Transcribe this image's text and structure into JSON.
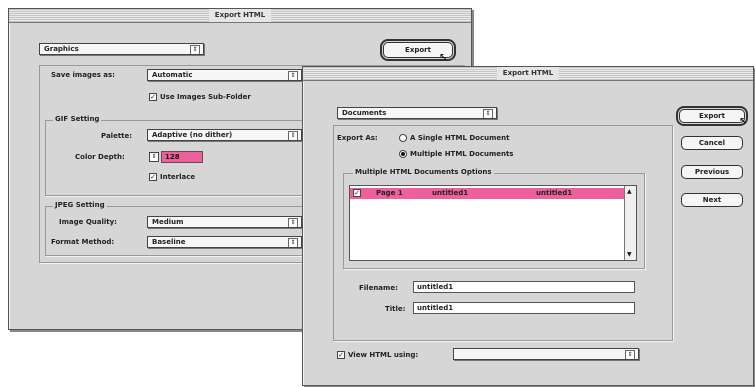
{
  "back_dialog": {
    "title": "Export HTML",
    "category": "Graphics",
    "export_button": "Export",
    "save_images_label": "Save images as:",
    "save_images_value": "Automatic",
    "use_images_subfolder": "Use Images Sub-Folder",
    "gif_setting_title": "GIF Setting",
    "palette_label": "Palette:",
    "palette_value": "Adaptive (no dither)",
    "color_depth_label": "Color Depth:",
    "color_depth_value": "128",
    "interlace_label": "Interlace",
    "jpeg_setting_title": "JPEG Setting",
    "image_quality_label": "Image Quality:",
    "image_quality_value": "Medium",
    "format_method_label": "Format Method:",
    "format_method_value": "Baseline"
  },
  "front_dialog": {
    "title": "Export HTML",
    "category": "Documents",
    "export_as_label": "Export As:",
    "option_single": "A Single HTML Document",
    "option_multiple": "Multiple HTML Documents",
    "options_group_title": "Multiple HTML Documents Options",
    "list_row": {
      "check": "✓",
      "page": "Page 1",
      "filename": "untitled1",
      "title": "untitled1"
    },
    "filename_label": "Filename:",
    "filename_value": "untitled1",
    "title_label": "Title:",
    "title_value": "untitled1",
    "view_html_label": "View HTML using:",
    "view_html_value": "",
    "buttons": {
      "export": "Export",
      "cancel": "Cancel",
      "previous": "Previous",
      "next": "Next"
    }
  },
  "icons": {
    "popup_arrow": "⇕",
    "check": "✓",
    "cursor": "↖"
  },
  "colors": {
    "highlight": "#ee5f9c",
    "window": "#d6d6d6"
  }
}
